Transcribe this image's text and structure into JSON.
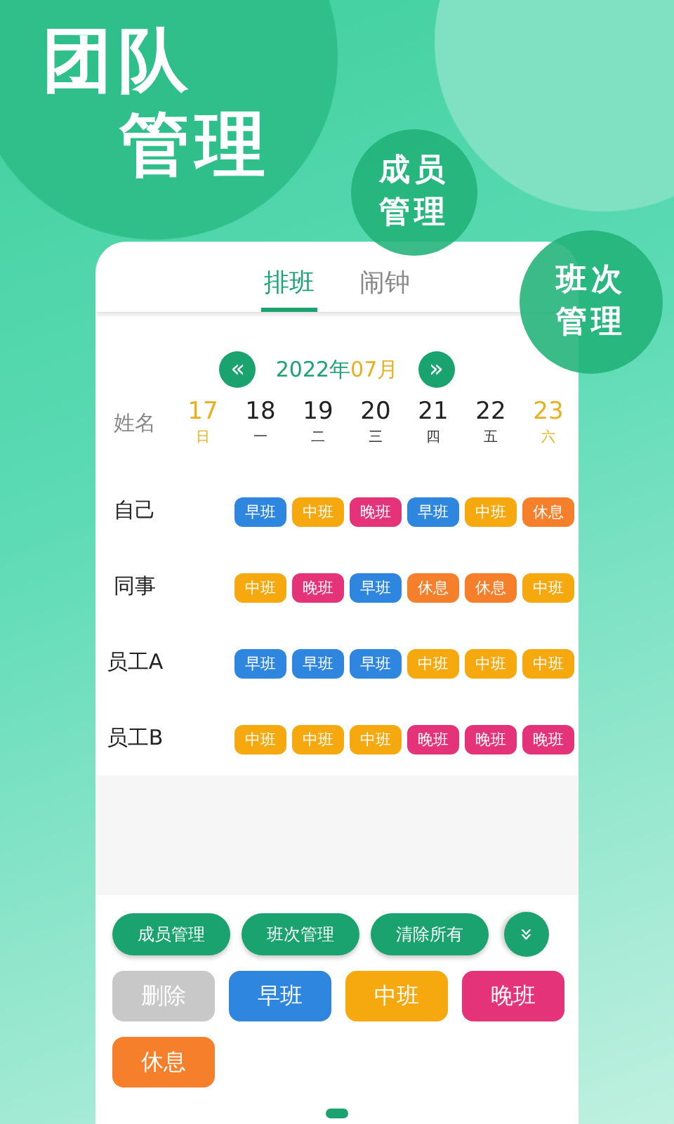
{
  "headline": [
    "团队",
    "管理"
  ],
  "bubbles": [
    {
      "lines": [
        "成员",
        "管理"
      ]
    },
    {
      "lines": [
        "班次",
        "管理"
      ]
    }
  ],
  "tabs": [
    {
      "label": "排班",
      "selected": true
    },
    {
      "label": "闹钟",
      "selected": false
    }
  ],
  "month_nav": {
    "prev": "«",
    "year": "2022年",
    "month": "07月",
    "next": "»"
  },
  "name_header": "姓名",
  "days": [
    {
      "date": "17",
      "weekday": "日",
      "weekend": true
    },
    {
      "date": "18",
      "weekday": "一",
      "weekend": false
    },
    {
      "date": "19",
      "weekday": "二",
      "weekend": false
    },
    {
      "date": "20",
      "weekday": "三",
      "weekend": false
    },
    {
      "date": "21",
      "weekday": "四",
      "weekend": false
    },
    {
      "date": "22",
      "weekday": "五",
      "weekend": false
    },
    {
      "date": "23",
      "weekday": "六",
      "weekend": true
    }
  ],
  "rows": [
    {
      "name": "自己",
      "shifts": [
        {
          "label": "早班",
          "kind": "early"
        },
        {
          "label": "中班",
          "kind": "mid"
        },
        {
          "label": "晚班",
          "kind": "late"
        },
        {
          "label": "早班",
          "kind": "early"
        },
        {
          "label": "中班",
          "kind": "mid"
        },
        {
          "label": "休息",
          "kind": "rest"
        }
      ]
    },
    {
      "name": "同事",
      "shifts": [
        {
          "label": "中班",
          "kind": "mid"
        },
        {
          "label": "晚班",
          "kind": "late"
        },
        {
          "label": "早班",
          "kind": "early"
        },
        {
          "label": "休息",
          "kind": "rest"
        },
        {
          "label": "休息",
          "kind": "rest"
        },
        {
          "label": "中班",
          "kind": "mid"
        }
      ]
    },
    {
      "name": "员工A",
      "shifts": [
        {
          "label": "早班",
          "kind": "early"
        },
        {
          "label": "早班",
          "kind": "early"
        },
        {
          "label": "早班",
          "kind": "early"
        },
        {
          "label": "中班",
          "kind": "mid"
        },
        {
          "label": "中班",
          "kind": "mid"
        },
        {
          "label": "中班",
          "kind": "mid"
        }
      ]
    },
    {
      "name": "员工B",
      "shifts": [
        {
          "label": "中班",
          "kind": "mid"
        },
        {
          "label": "中班",
          "kind": "mid"
        },
        {
          "label": "中班",
          "kind": "mid"
        },
        {
          "label": "晚班",
          "kind": "late"
        },
        {
          "label": "晚班",
          "kind": "late"
        },
        {
          "label": "晚班",
          "kind": "late"
        }
      ]
    }
  ],
  "actions": [
    "成员管理",
    "班次管理",
    "清除所有"
  ],
  "expand": "»",
  "shift_buttons": [
    {
      "label": "删除",
      "kind": "delete"
    },
    {
      "label": "早班",
      "kind": "early"
    },
    {
      "label": "中班",
      "kind": "mid"
    },
    {
      "label": "晚班",
      "kind": "late"
    },
    {
      "label": "休息",
      "kind": "rest"
    }
  ]
}
